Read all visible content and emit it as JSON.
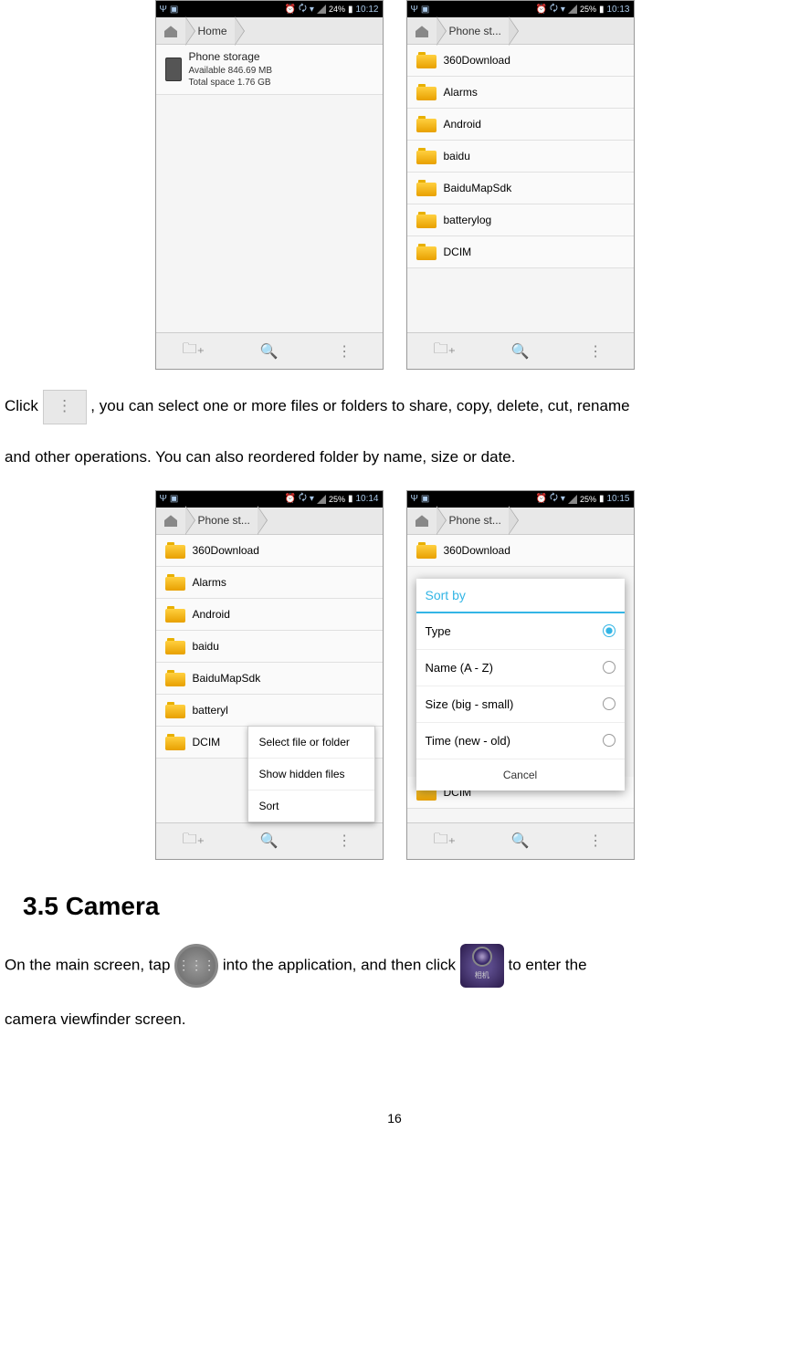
{
  "screenshots": {
    "s1": {
      "status": {
        "battery": "24%",
        "time": "10:12"
      },
      "breadcrumb": {
        "home": "Home"
      },
      "storage": {
        "title": "Phone storage",
        "available": "Available 846.69 MB",
        "total": "Total space 1.76 GB"
      }
    },
    "s2": {
      "status": {
        "battery": "25%",
        "time": "10:13"
      },
      "breadcrumb": {
        "path": "Phone st..."
      },
      "folders": [
        "360Download",
        "Alarms",
        "Android",
        "baidu",
        "BaiduMapSdk",
        "batterylog",
        "DCIM"
      ]
    },
    "s3": {
      "status": {
        "battery": "25%",
        "time": "10:14"
      },
      "breadcrumb": {
        "path": "Phone st..."
      },
      "folders": [
        "360Download",
        "Alarms",
        "Android",
        "baidu",
        "BaiduMapSdk",
        "batteryl",
        "DCIM"
      ],
      "menu": [
        "Select file or folder",
        "Show hidden files",
        "Sort"
      ]
    },
    "s4": {
      "status": {
        "battery": "25%",
        "time": "10:15"
      },
      "breadcrumb": {
        "path": "Phone st..."
      },
      "folders": [
        "360Download",
        "DCIM"
      ],
      "dialog": {
        "title": "Sort by",
        "options": [
          "Type",
          "Name (A - Z)",
          "Size (big - small)",
          "Time (new - old)"
        ],
        "selected": 0,
        "cancel": "Cancel"
      }
    }
  },
  "text": {
    "p1a": "Click ",
    "p1b": ", you can select one or more files or folders to share, copy, delete, cut, rename",
    "p2": "and other operations. You can also reordered folder by name, size or date.",
    "heading": "3.5 Camera",
    "p3a": "On the main screen, tap ",
    "p3b": " into the application, and then click ",
    "p3c": " to enter the",
    "p4": "camera viewfinder screen.",
    "camera_label": "相机"
  },
  "page_number": "16"
}
